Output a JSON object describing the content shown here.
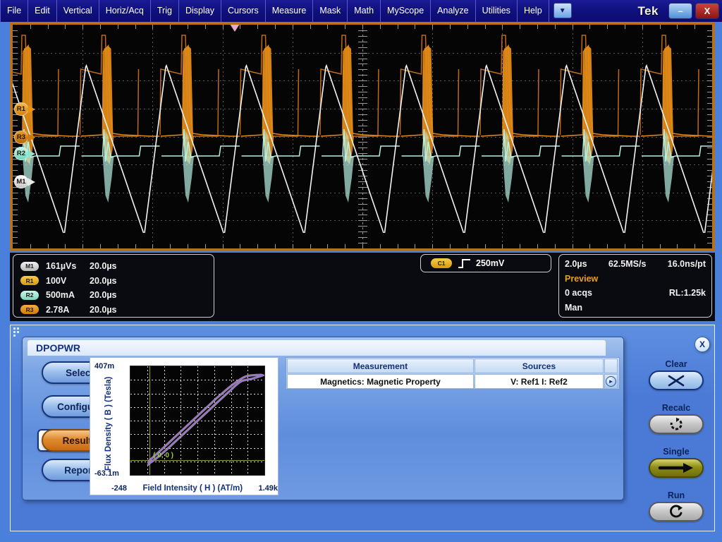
{
  "menubar": {
    "items": [
      "File",
      "Edit",
      "Vertical",
      "Horiz/Acq",
      "Trig",
      "Display",
      "Cursors",
      "Measure",
      "Mask",
      "Math",
      "MyScope",
      "Analyze",
      "Utilities",
      "Help"
    ],
    "dropdown_icon": "chevron-down-icon",
    "brand": "Tek",
    "minimize_label": "–",
    "close_label": "X"
  },
  "scope": {
    "trigger_marker_icon": "trigger-position-marker",
    "channel_markers": [
      {
        "label": "R1",
        "color": "#e8941a",
        "y": 145
      },
      {
        "label": "R3",
        "color": "#d07a10",
        "y": 185
      },
      {
        "label": "R2",
        "color": "#8fe6d0",
        "y": 208
      },
      {
        "label": "M1",
        "color": "#e8e8e8",
        "y": 248
      }
    ]
  },
  "readout": {
    "measurements": [
      {
        "badge": "M1",
        "badge_color": "#d8d8d8",
        "value": "161µVs",
        "timebase": "20.0µs"
      },
      {
        "badge": "R1",
        "badge_color": "#e8b41a",
        "value": "100V",
        "timebase": "20.0µs"
      },
      {
        "badge": "R2",
        "badge_color": "#8fe6d0",
        "value": "500mA",
        "timebase": "20.0µs"
      },
      {
        "badge": "R3",
        "badge_color": "#e0921a",
        "value": "2.78A",
        "timebase": "20.0µs"
      }
    ],
    "trigger": {
      "badge": "C1",
      "badge_color": "#e8b41a",
      "slope_icon": "rising-edge-icon",
      "slope_glyph": "∫",
      "level": "250mV"
    },
    "acquisition": {
      "timebase": "2.0µs",
      "sample_rate": "62.5MS/s",
      "resolution": "16.0ns/pt",
      "status": "Preview",
      "acqs": "0 acqs",
      "record_length": "RL:1.25k",
      "mode": "Man"
    }
  },
  "dialog": {
    "title": "DPOPWR",
    "close_label": "X",
    "nav": [
      {
        "label": "Select",
        "active": false
      },
      {
        "label": "Configure",
        "active": false
      },
      {
        "label": "Results",
        "active": true
      },
      {
        "label": "Report",
        "active": false
      }
    ],
    "table": {
      "headers": [
        "Measurement",
        "Sources",
        ""
      ],
      "rows": [
        {
          "measurement": "Magnetics: Magnetic Property",
          "sources": "V: Ref1   I: Ref2",
          "expand_icon": "play-arrow-icon"
        }
      ]
    },
    "controls": [
      {
        "label": "Clear",
        "icon": "clear-x-icon",
        "style": "blue"
      },
      {
        "label": "Recalc",
        "icon": "recalculate-icon",
        "style": "gray"
      },
      {
        "label": "Single",
        "icon": "single-arrow-icon",
        "style": "olive"
      },
      {
        "label": "Run",
        "icon": "run-loop-arrow-icon",
        "style": "gray"
      }
    ]
  },
  "chart_data": {
    "type": "scatter",
    "title": "",
    "xlabel": "Field Intensity ( H ) (AT/m)",
    "ylabel": "Flux Density ( B ) (Tesla)",
    "xlim": [
      -248,
      1490
    ],
    "ylim": [
      -0.0631,
      0.407
    ],
    "xtick_labels": [
      "-248",
      "1.49k"
    ],
    "ytick_labels": [
      "407m",
      "-63.1m"
    ],
    "origin_annotation": "( 0, 0 )",
    "grid": true,
    "legend": "none",
    "trace_color": "#8a7ad8",
    "trace_highlight_color": "#d8a070",
    "description": "B-H hysteresis loop, near-linear rising trace from origin to upper-right saturation knee",
    "points": [
      [
        -20,
        -0.012
      ],
      [
        0,
        0.0
      ],
      [
        60,
        0.018
      ],
      [
        140,
        0.042
      ],
      [
        230,
        0.07
      ],
      [
        320,
        0.098
      ],
      [
        410,
        0.126
      ],
      [
        500,
        0.154
      ],
      [
        590,
        0.182
      ],
      [
        680,
        0.21
      ],
      [
        770,
        0.238
      ],
      [
        860,
        0.266
      ],
      [
        950,
        0.292
      ],
      [
        1020,
        0.312
      ],
      [
        1080,
        0.328
      ],
      [
        1130,
        0.34
      ],
      [
        1175,
        0.35
      ],
      [
        1205,
        0.356
      ],
      [
        1240,
        0.362
      ],
      [
        1280,
        0.366
      ],
      [
        1330,
        0.368
      ],
      [
        1390,
        0.369
      ],
      [
        1450,
        0.37
      ],
      [
        1470,
        0.368
      ],
      [
        1400,
        0.36
      ],
      [
        1320,
        0.352
      ],
      [
        1250,
        0.348
      ],
      [
        1200,
        0.344
      ],
      [
        1160,
        0.336
      ],
      [
        1110,
        0.322
      ],
      [
        1040,
        0.3
      ],
      [
        960,
        0.276
      ],
      [
        870,
        0.248
      ],
      [
        780,
        0.22
      ],
      [
        690,
        0.192
      ],
      [
        600,
        0.164
      ],
      [
        510,
        0.136
      ],
      [
        420,
        0.108
      ],
      [
        330,
        0.08
      ],
      [
        240,
        0.052
      ],
      [
        150,
        0.026
      ],
      [
        70,
        0.004
      ],
      [
        10,
        -0.01
      ],
      [
        -25,
        -0.02
      ]
    ]
  }
}
